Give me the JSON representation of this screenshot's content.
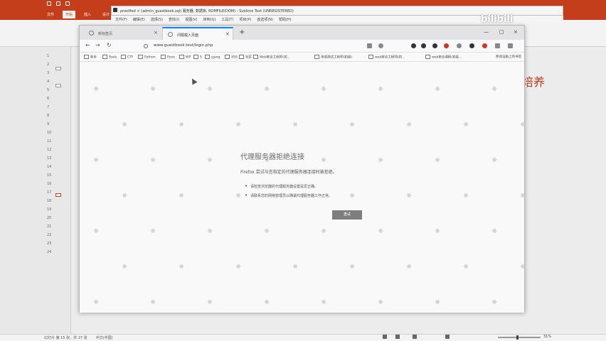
{
  "ppt": {
    "tabs": [
      "文件",
      "开始",
      "插入",
      "设计"
    ],
    "slide_numbers": [
      "1",
      "2",
      "3",
      "4",
      "5",
      "6",
      "7",
      "8",
      "9",
      "10",
      "11",
      "12",
      "13",
      "14",
      "15",
      "16",
      "17",
      "18",
      "19",
      "20",
      "21",
      "22",
      "23",
      "24"
    ],
    "slide_text": "培养",
    "status_slide": "幻灯片 第 15 张，共 27 张",
    "status_lang": "中文(中国)",
    "zoom": "31%"
  },
  "watermark": {
    "text": "bilibili",
    "logo_color": "#000000"
  },
  "editor": {
    "title": "proxified × (admin_guestbook.sql) 服务器, 数据库, ROMFILE(DOM) - Sublime Text (UNREGISTERED)",
    "menu": [
      "文件(F)",
      "编辑(E)",
      "选择(S)",
      "查找(I)",
      "视图(V)",
      "转到(G)",
      "工具(T)",
      "项目(P)",
      "首选项(N)",
      "帮助(H)"
    ]
  },
  "firefox": {
    "tabs": [
      {
        "label": "新标签页",
        "active": false
      },
      {
        "label": "问题载入页面",
        "active": true
      }
    ],
    "url": "www.guestbook.test/login.php",
    "bookmarks": [
      "新手",
      "Tools",
      "CTF",
      "Python",
      "Pyoo",
      "WP",
      "S",
      "yjang",
      "XSS",
      "社区",
      "Web安全工程师(初...",
      "渗透测试工程师(初级)",
      "web安全工程师(初...",
      "web安全课程(初级..."
    ],
    "bookmarks_more": "移动设备上的书签",
    "error": {
      "title": "代理服务器拒绝连接",
      "description": "Firefox 尝试与您指定的代理服务器连接时被拒绝。",
      "items": [
        "请检查浏览器的代理服务器设置是否正确。",
        "请联系您的网络管理员以确认代理服务器工作正常。"
      ],
      "button": "重试"
    }
  }
}
